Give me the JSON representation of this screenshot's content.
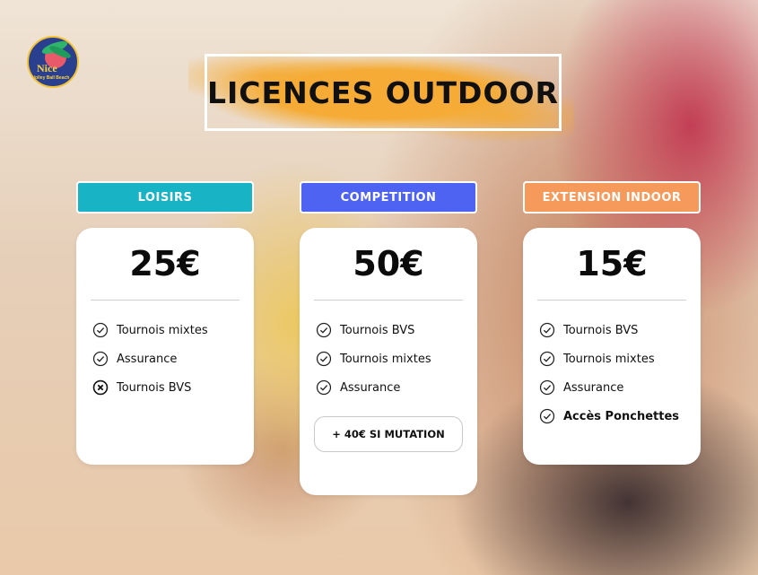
{
  "logo": {
    "line1": "Nice",
    "line2": "Volley Ball Beach"
  },
  "title": "LICENCES OUTDOOR",
  "colors": {
    "loisirs": "#19b3c6",
    "competition": "#4f63f2",
    "extension": "#f69a5b",
    "title_splash": "#f5ab35"
  },
  "plans": [
    {
      "name": "LOISIRS",
      "price": "25€",
      "features": [
        {
          "label": "Tournois mixtes",
          "icon": "check-circle-icon",
          "bold": false
        },
        {
          "label": "Assurance",
          "icon": "check-circle-icon",
          "bold": false
        },
        {
          "label": "Tournois BVS",
          "icon": "x-circle-icon",
          "bold": false
        }
      ]
    },
    {
      "name": "COMPETITION",
      "price": "50€",
      "features": [
        {
          "label": "Tournois BVS",
          "icon": "check-circle-icon",
          "bold": false
        },
        {
          "label": "Tournois mixtes",
          "icon": "check-circle-icon",
          "bold": false
        },
        {
          "label": "Assurance",
          "icon": "check-circle-icon",
          "bold": false
        }
      ],
      "extra_button": "+ 40€ SI MUTATION"
    },
    {
      "name": "EXTENSION INDOOR",
      "price": "15€",
      "features": [
        {
          "label": "Tournois BVS",
          "icon": "check-circle-icon",
          "bold": false
        },
        {
          "label": "Tournois mixtes",
          "icon": "check-circle-icon",
          "bold": false
        },
        {
          "label": "Assurance",
          "icon": "check-circle-icon",
          "bold": false
        },
        {
          "label": "Accès Ponchettes",
          "icon": "check-circle-icon",
          "bold": true
        }
      ]
    }
  ]
}
